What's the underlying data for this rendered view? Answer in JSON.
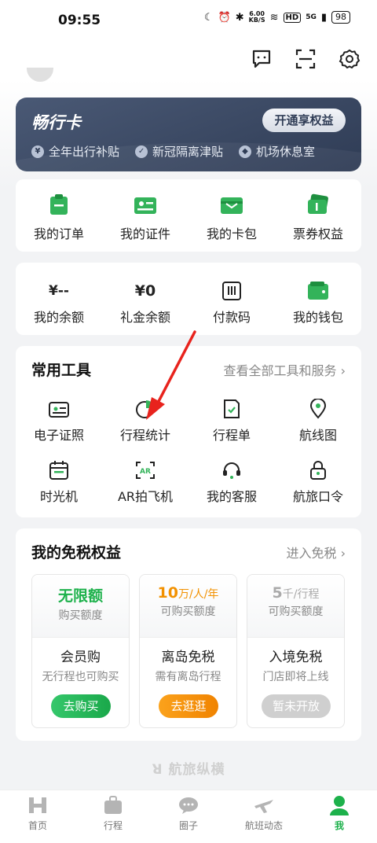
{
  "status_bar": {
    "time": "09:55",
    "net_speed_value": "6.00",
    "net_speed_unit": "KB/S",
    "hd": "HD",
    "signal": "5G",
    "battery": "98"
  },
  "vip": {
    "title": "畅行卡",
    "button": "开通享权益",
    "perks": [
      "全年出行补贴",
      "新冠隔离津贴",
      "机场休息室"
    ]
  },
  "quick_links": [
    "我的订单",
    "我的证件",
    "我的卡包",
    "票券权益"
  ],
  "wallet": {
    "balance_value": "¥--",
    "balance_label": "我的余额",
    "gift_value": "¥0",
    "gift_label": "礼金余额",
    "pay_label": "付款码",
    "wallet_label": "我的钱包"
  },
  "tools": {
    "title": "常用工具",
    "link": "查看全部工具和服务",
    "row1": [
      "电子证照",
      "行程统计",
      "行程单",
      "航线图"
    ],
    "row2": [
      "时光机",
      "AR拍飞机",
      "我的客服",
      "航旅口令"
    ]
  },
  "duty_free": {
    "title": "我的免税权益",
    "link": "进入免税",
    "items": [
      {
        "value": "无限额",
        "unit": "",
        "sub": "购买额度",
        "name": "会员购",
        "desc": "无行程也可购买",
        "button": "去购买",
        "color": "#1db14b"
      },
      {
        "value": "10",
        "unit": "万/人/年",
        "sub": "可购买额度",
        "name": "离岛免税",
        "desc": "需有离岛行程",
        "button": "去逛逛",
        "color": "#f29100"
      },
      {
        "value": "5",
        "unit": "千/行程",
        "sub": "可购买额度",
        "name": "入境免税",
        "desc": "门店即将上线",
        "button": "暂未开放",
        "color": "#bbbbbb"
      }
    ]
  },
  "brand": "航旅纵横",
  "tabs": [
    "首页",
    "行程",
    "圈子",
    "航班动态",
    "我"
  ],
  "colors": {
    "accent": "#1db14b",
    "vip_bg": "#3b4863",
    "orange": "#f29100"
  }
}
